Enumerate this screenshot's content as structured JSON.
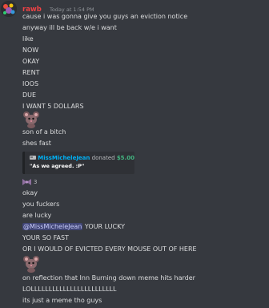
{
  "header": {
    "username": "rawb",
    "timestamp": "Today at 1:54 PM"
  },
  "messages": {
    "m1": "cause i was gonna give you guys an eviction notice",
    "m2": "anyway ill be back w/e i want",
    "m3": "like",
    "m4": "NOW",
    "m5": "OKAY",
    "m6": "RENT",
    "m7": "IOOS",
    "m8": "DUE",
    "m9": "I WANT 5 DOLLARS",
    "m10": "son of a bitch",
    "m11": "shes fast",
    "m12": "okay",
    "m13": "you fuckers",
    "m14": "are lucky",
    "m15_mention": "@MissMicheleJean",
    "m15_rest": " YOUR LUCKY",
    "m16": "YOUR SO FAST",
    "m17": "OR I WOULD OF EVICTED EVERY MOUSE OUT OF HERE",
    "m18": "on reflection that Inn Burning down meme hits harder",
    "m19": "LOLLLLLLLLLLLLLLLLLLLLLLLL",
    "m20": "its just a meme tho guys"
  },
  "embed": {
    "donor": "MissMicheleJean",
    "action": "donated",
    "amount": "$5.00",
    "note": "\"As we agreed. :P\""
  },
  "reaction": {
    "count": "3"
  },
  "icons": {
    "avatar": "avatar-image",
    "emoji": "mouse-emoji",
    "donation": "donation-icon",
    "reaction": "bow-emoji"
  },
  "colors": {
    "background": "#36393f",
    "username": "#ed4245",
    "donor": "#00b0f4",
    "amount": "#43b581",
    "mention_bg": "#414675"
  }
}
